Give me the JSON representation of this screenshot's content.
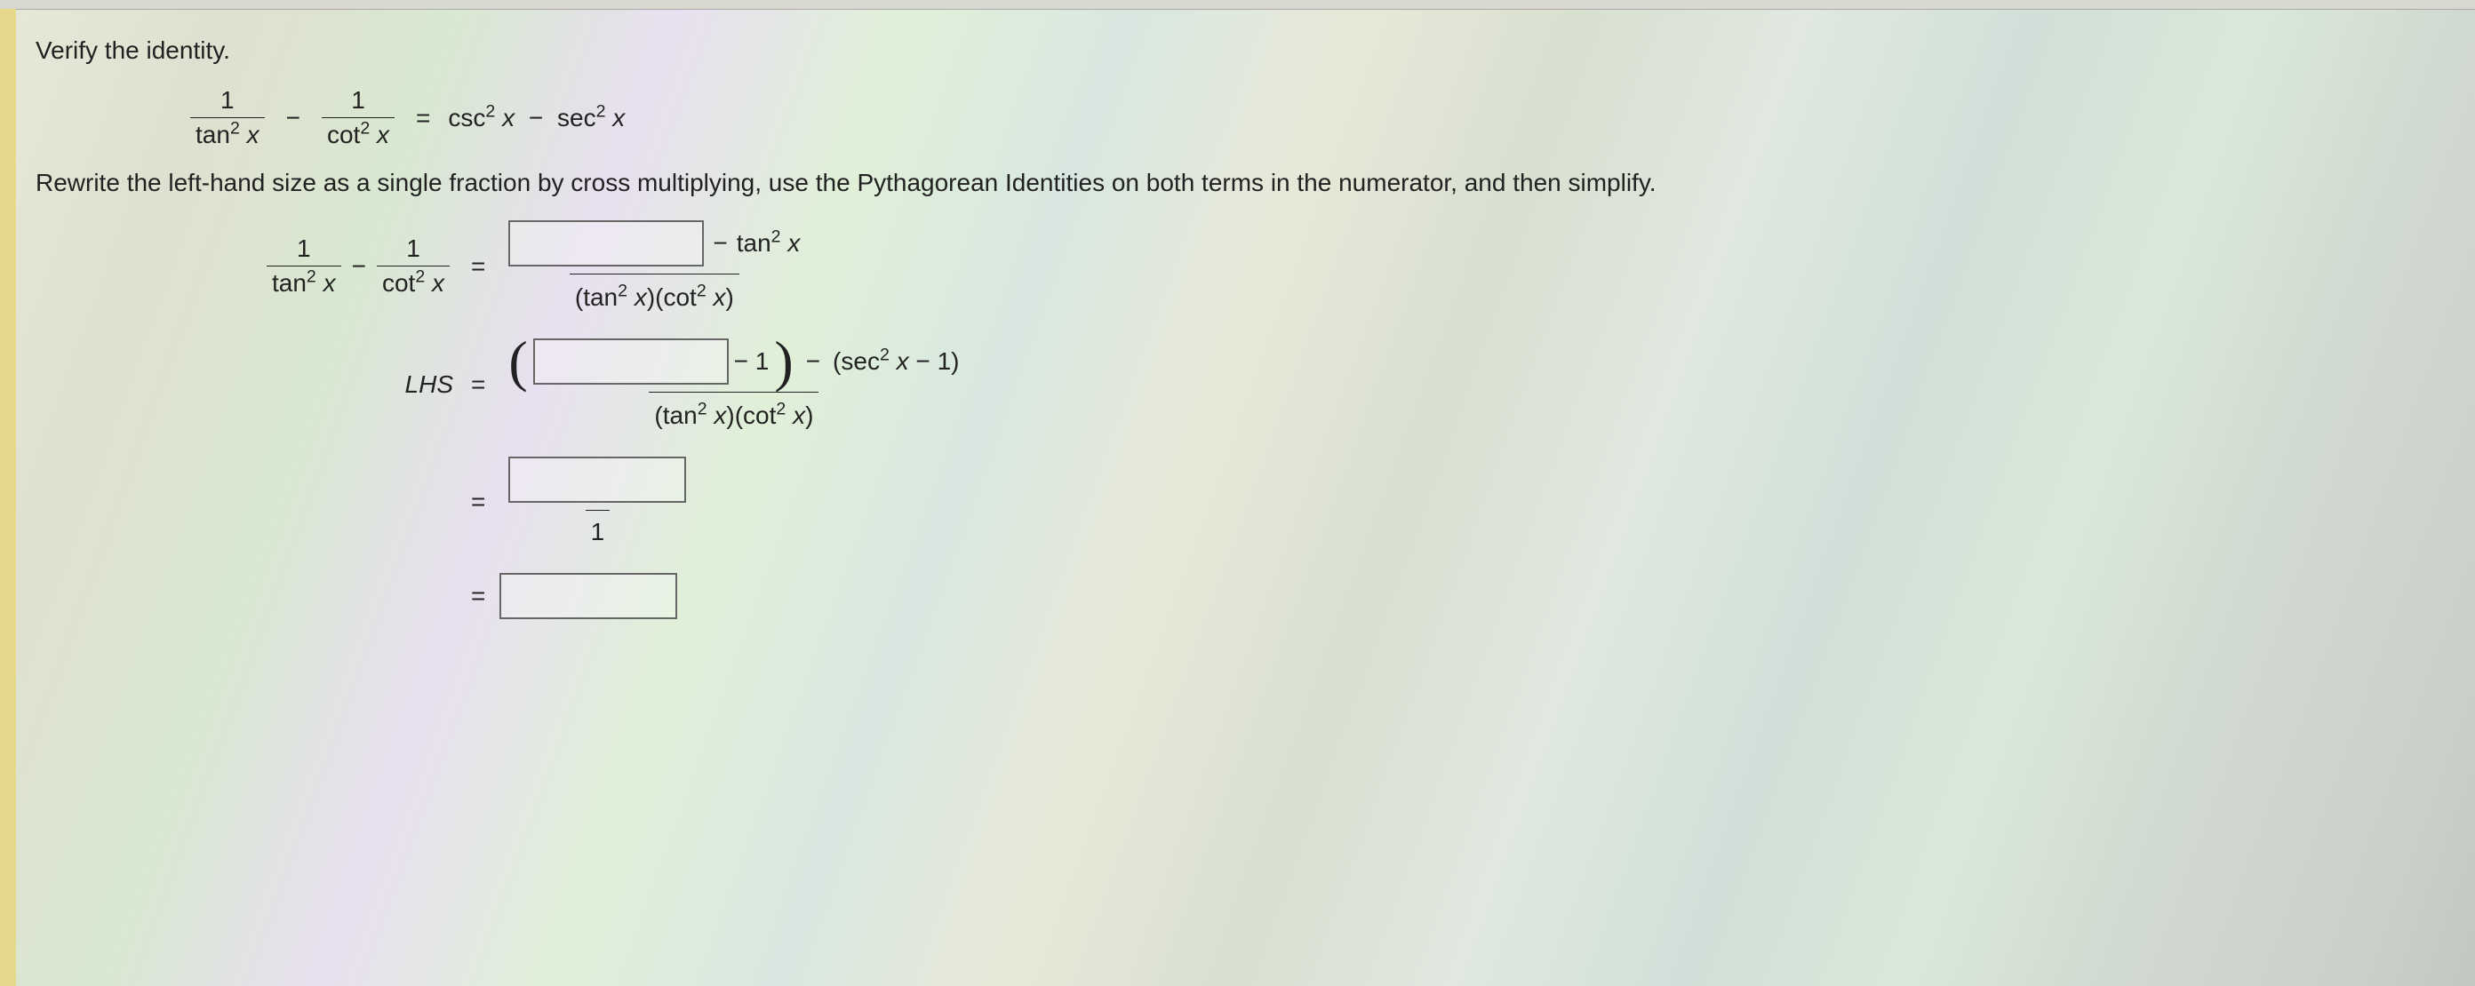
{
  "prompt": "Verify the identity.",
  "identity": {
    "lhs_frac1_num": "1",
    "lhs_frac1_den_fn": "tan",
    "lhs_frac2_num": "1",
    "lhs_frac2_den_fn": "cot",
    "rhs_term1_fn": "csc",
    "rhs_term2_fn": "sec",
    "sq": "2",
    "x": "x"
  },
  "instruction": "Rewrite the left-hand size as a single fraction by cross multiplying, use the Pythagorean Identities on both terms in the numerator, and then simplify.",
  "lhs_label": "LHS",
  "steps": {
    "s1": {
      "num_after_box_minus": "tan",
      "den": "(tan² x)(cot² x)"
    },
    "s2": {
      "after_box": " − 1",
      "minus_paren": "(sec² x − 1)",
      "den": "(tan² x)(cot² x)"
    },
    "s3": {
      "den": "1"
    }
  },
  "minus": "−",
  "equals": "=",
  "one": "1"
}
